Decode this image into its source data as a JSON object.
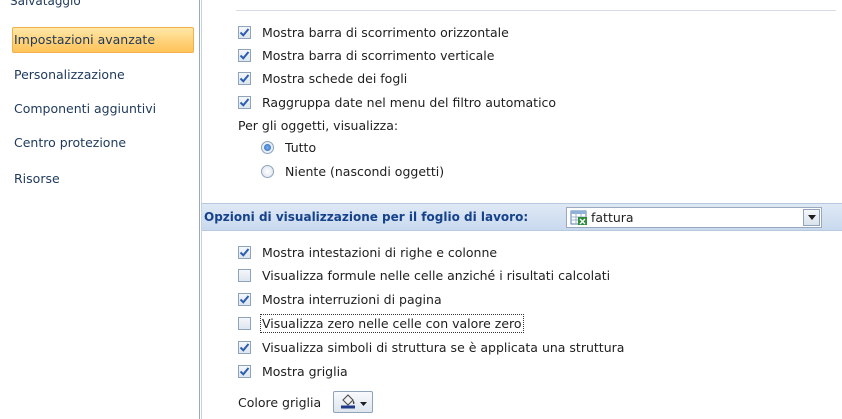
{
  "sidebar": {
    "cut_label": "Salvataggio",
    "items": [
      {
        "label": "Impostazioni avanzate",
        "selected": true
      },
      {
        "label": "Personalizzazione"
      },
      {
        "label": "Componenti aggiuntivi"
      },
      {
        "label": "Centro protezione"
      },
      {
        "label": "Risorse"
      }
    ]
  },
  "display_options": [
    {
      "label": "Mostra barra di scorrimento orizzontale",
      "checked": true
    },
    {
      "label": "Mostra barra di scorrimento verticale",
      "checked": true
    },
    {
      "label": "Mostra schede dei fogli",
      "checked": true
    },
    {
      "label": "Raggruppa date nel menu del filtro automatico",
      "checked": true
    }
  ],
  "objects": {
    "heading": "Per gli oggetti, visualizza:",
    "options": [
      {
        "label": "Tutto",
        "selected": true
      },
      {
        "label": "Niente (nascondi oggetti)",
        "selected": false
      }
    ]
  },
  "sheet_section": {
    "title": "Opzioni di visualizzazione per il foglio di lavoro:",
    "selected_sheet": "fattura",
    "sheet_icon": "excel-sheet-icon"
  },
  "sheet_options": [
    {
      "label": "Mostra intestazioni di righe e colonne",
      "checked": true
    },
    {
      "label": "Visualizza formule nelle celle anziché i risultati calcolati",
      "checked": false
    },
    {
      "label": "Mostra interruzioni di pagina",
      "checked": true
    },
    {
      "label": "Visualizza zero nelle celle con valore zero",
      "checked": false,
      "focused": true
    },
    {
      "label": "Visualizza simboli di struttura se è applicata una struttura",
      "checked": true
    },
    {
      "label": "Mostra griglia",
      "checked": true
    }
  ],
  "grid_color": {
    "label": "Colore griglia",
    "icon": "paint-bucket-icon",
    "swatch_color": "#1f3a8a"
  },
  "colors": {
    "accent_header": "#15428b",
    "selected_item": "#ffd27a",
    "check_mark": "#2a5db0"
  }
}
